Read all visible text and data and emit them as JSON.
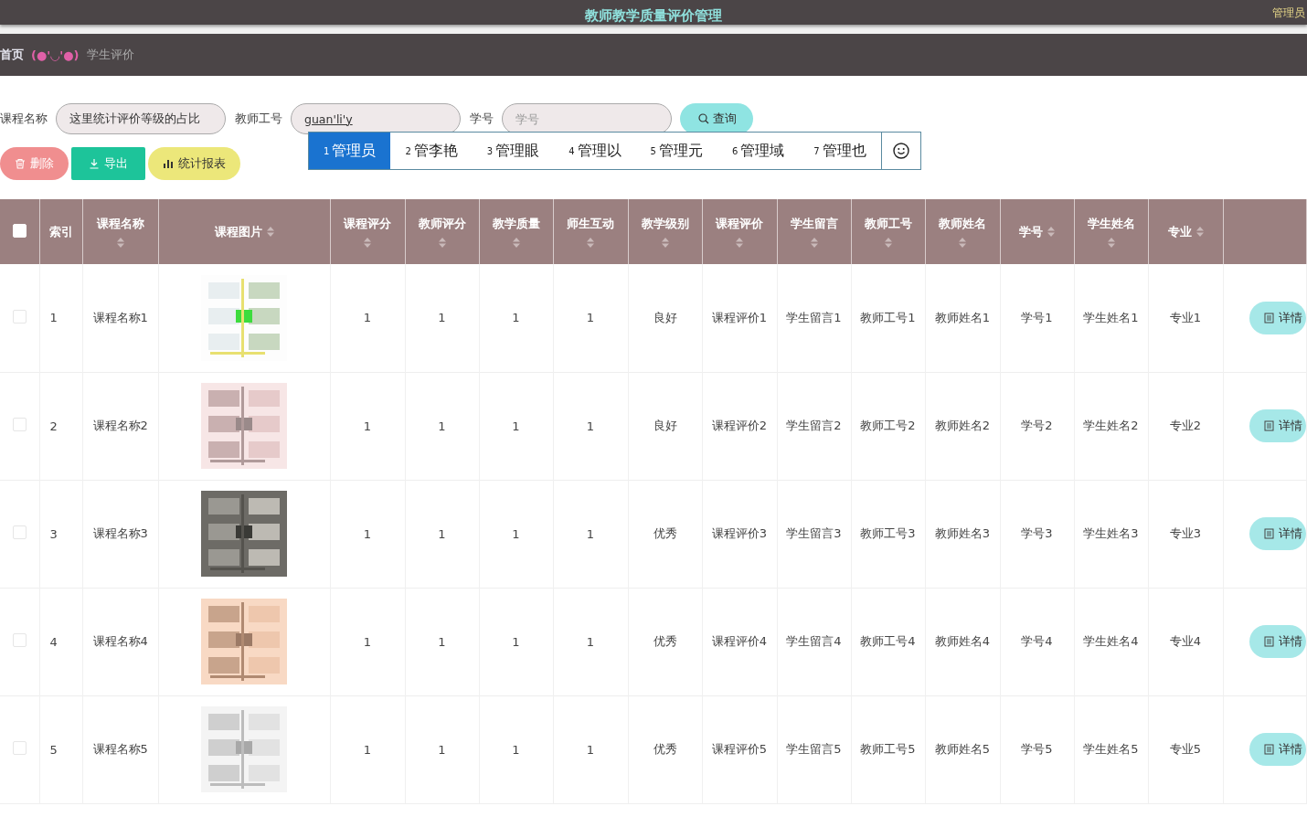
{
  "header": {
    "title": "教师教学质量评价管理",
    "user": "管理员"
  },
  "breadcrumb": {
    "home": "首页",
    "emoticon": "(●'◡'●)",
    "current": "学生评价"
  },
  "search": {
    "fields": [
      {
        "label": "课程名称",
        "value": "这里统计评价等级的占比"
      },
      {
        "label": "教师工号",
        "value": "guan'li'y"
      },
      {
        "label": "学号",
        "placeholder": "学号"
      }
    ],
    "button": "查询"
  },
  "ime": {
    "candidates": [
      {
        "index": "1",
        "text": "管理员",
        "selected": true
      },
      {
        "index": "2",
        "text": "管李艳",
        "selected": false
      },
      {
        "index": "3",
        "text": "管理眼",
        "selected": false
      },
      {
        "index": "4",
        "text": "管理以",
        "selected": false
      },
      {
        "index": "5",
        "text": "管理元",
        "selected": false
      },
      {
        "index": "6",
        "text": "管理域",
        "selected": false
      },
      {
        "index": "7",
        "text": "管理也",
        "selected": false
      }
    ]
  },
  "actions": [
    {
      "kind": "delete",
      "label": "删除"
    },
    {
      "kind": "export",
      "label": "导出"
    },
    {
      "kind": "report",
      "label": "统计报表"
    }
  ],
  "table": {
    "header_checked": false,
    "columns": [
      {
        "title": "索引",
        "sortable": false
      },
      {
        "title": "课程名称",
        "sortable": true
      },
      {
        "title": "课程图片",
        "sortable": true
      },
      {
        "title": "课程评分",
        "sortable": true
      },
      {
        "title": "教师评分",
        "sortable": true
      },
      {
        "title": "教学质量",
        "sortable": true
      },
      {
        "title": "师生互动",
        "sortable": true
      },
      {
        "title": "教学级别",
        "sortable": true
      },
      {
        "title": "课程评价",
        "sortable": true
      },
      {
        "title": "学生留言",
        "sortable": true
      },
      {
        "title": "教师工号",
        "sortable": true
      },
      {
        "title": "教师姓名",
        "sortable": true
      },
      {
        "title": "学号",
        "sortable": true
      },
      {
        "title": "学生姓名",
        "sortable": true
      },
      {
        "title": "专业",
        "sortable": true
      }
    ],
    "rows": [
      {
        "checked": false,
        "cells": [
          "1",
          "课程名称1",
          {
            "kind": "picture"
          },
          "1",
          "1",
          "1",
          "1",
          "良好",
          "课程评价1",
          "学生留言1",
          "教师工号1",
          "教师姓名1",
          "学号1",
          "学生姓名1",
          "专业1"
        ],
        "action": "详情"
      },
      {
        "checked": false,
        "cells": [
          "2",
          "课程名称2",
          {
            "kind": "picture"
          },
          "1",
          "1",
          "1",
          "1",
          "良好",
          "课程评价2",
          "学生留言2",
          "教师工号2",
          "教师姓名2",
          "学号2",
          "学生姓名2",
          "专业2"
        ],
        "action": "详情"
      },
      {
        "checked": false,
        "cells": [
          "3",
          "课程名称3",
          {
            "kind": "picture"
          },
          "1",
          "1",
          "1",
          "1",
          "优秀",
          "课程评价3",
          "学生留言3",
          "教师工号3",
          "教师姓名3",
          "学号3",
          "学生姓名3",
          "专业3"
        ],
        "action": "详情"
      },
      {
        "checked": false,
        "cells": [
          "4",
          "课程名称4",
          {
            "kind": "picture"
          },
          "1",
          "1",
          "1",
          "1",
          "优秀",
          "课程评价4",
          "学生留言4",
          "教师工号4",
          "教师姓名4",
          "学号4",
          "学生姓名4",
          "专业4"
        ],
        "action": "详情"
      },
      {
        "checked": false,
        "cells": [
          "5",
          "课程名称5",
          {
            "kind": "picture"
          },
          "1",
          "1",
          "1",
          "1",
          "优秀",
          "课程评价5",
          "学生留言5",
          "教师工号5",
          "教师姓名5",
          "学号5",
          "学生姓名5",
          "专业5"
        ],
        "action": "详情"
      }
    ]
  }
}
